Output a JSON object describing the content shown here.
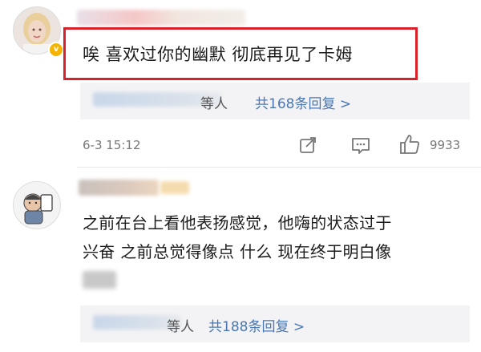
{
  "comments": [
    {
      "text": "唉 喜欢过你的幽默 彻底再见了卡姆",
      "reply_suffix": "等人",
      "reply_link": "共168条回复 >",
      "time": "6-3 15:12",
      "likes": "9933"
    },
    {
      "text_line1": "之前在台上看他表扬感觉，他嗨的状态过于",
      "text_line2": "兴奋 之前总觉得像点 什么 现在终于明白像",
      "reply_suffix": "等人",
      "reply_link": "共188条回复 >"
    }
  ],
  "icons": [
    "share-icon",
    "comment-icon",
    "like-icon",
    "verified-badge-icon"
  ],
  "colors": {
    "highlight": "#d8212b",
    "link": "#4a77b4",
    "badge": "#f6b400"
  }
}
